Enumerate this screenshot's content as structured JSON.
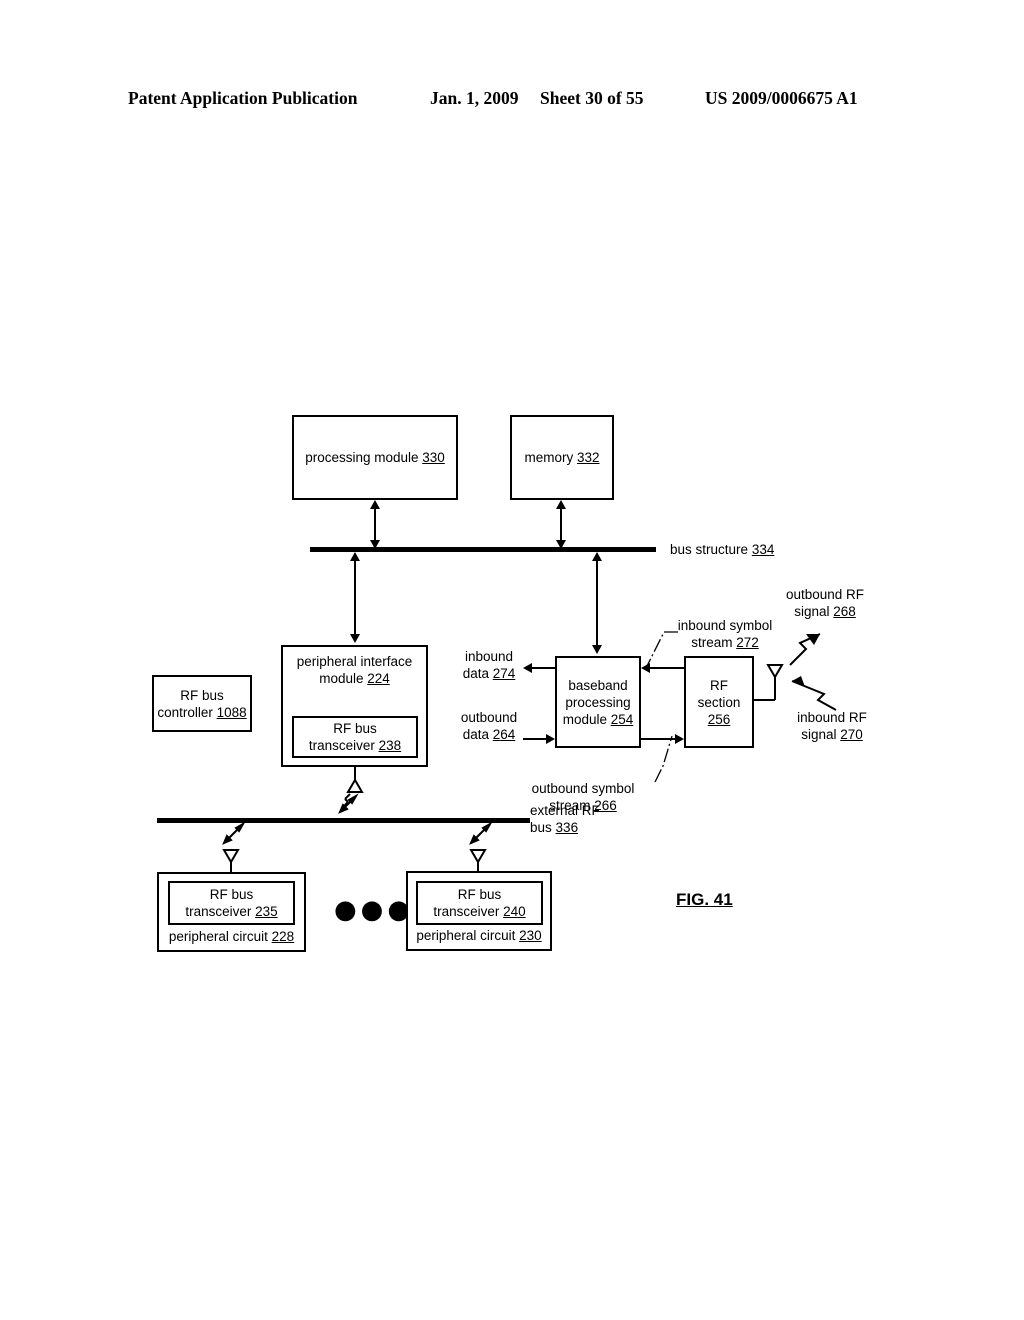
{
  "header": {
    "publication": "Patent Application Publication",
    "date": "Jan. 1, 2009",
    "sheet": "Sheet 30 of 55",
    "patent_number": "US 2009/0006675 A1"
  },
  "figure": {
    "label": "FIG. 41"
  },
  "blocks": {
    "processing_module": {
      "line1": "processing module",
      "ref": "330"
    },
    "memory": {
      "line1": "memory",
      "ref": "332"
    },
    "peripheral_interface_module": {
      "line1": "peripheral interface",
      "line2": "module",
      "ref": "224"
    },
    "rf_bus_transceiver_238": {
      "line1": "RF bus",
      "line2": "transceiver",
      "ref": "238"
    },
    "rf_bus_controller": {
      "line1": "RF bus",
      "line2": "controller",
      "ref": "1088"
    },
    "baseband_processing_module": {
      "line1": "baseband",
      "line2": "processing",
      "line3": "module",
      "ref": "254"
    },
    "rf_section": {
      "line1": "RF",
      "line2": "section",
      "ref": "256"
    },
    "peripheral_circuit_228": {
      "line1": "peripheral circuit",
      "ref": "228"
    },
    "rf_bus_transceiver_235": {
      "line1": "RF bus",
      "line2": "transceiver",
      "ref": "235"
    },
    "peripheral_circuit_230": {
      "line1": "peripheral circuit",
      "ref": "230"
    },
    "rf_bus_transceiver_240": {
      "line1": "RF bus",
      "line2": "transceiver",
      "ref": "240"
    },
    "ellipsis": "●●●"
  },
  "labels": {
    "bus_structure": {
      "line1": "bus structure",
      "ref": "334"
    },
    "external_rf_bus": {
      "line1": "external RF",
      "line2": "bus",
      "ref": "336"
    },
    "inbound_data": {
      "line1": "inbound",
      "line2": "data",
      "ref": "274"
    },
    "outbound_data": {
      "line1": "outbound",
      "line2": "data",
      "ref": "264"
    },
    "inbound_symbol_stream": {
      "line1": "inbound symbol",
      "line2": "stream",
      "ref": "272"
    },
    "outbound_symbol_stream": {
      "line1": "outbound symbol",
      "line2": "stream",
      "ref": "266"
    },
    "outbound_rf_signal": {
      "line1": "outbound RF",
      "line2": "signal",
      "ref": "268"
    },
    "inbound_rf_signal": {
      "line1": "inbound RF",
      "line2": "signal",
      "ref": "270"
    }
  },
  "colors": {
    "ink": "#000000",
    "paper": "#ffffff"
  }
}
